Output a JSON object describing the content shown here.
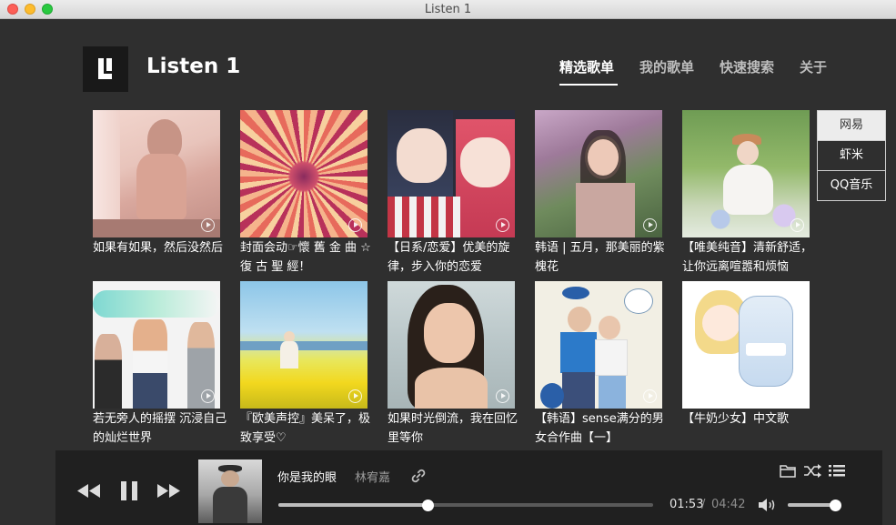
{
  "window": {
    "title": "Listen 1"
  },
  "app": {
    "name": "Listen 1"
  },
  "nav": [
    {
      "label": "精选歌单",
      "active": true
    },
    {
      "label": "我的歌单",
      "active": false
    },
    {
      "label": "快速搜索",
      "active": false
    },
    {
      "label": "关于",
      "active": false
    }
  ],
  "sources": [
    {
      "label": "网易",
      "active": true
    },
    {
      "label": "虾米",
      "active": false
    },
    {
      "label": "QQ音乐",
      "active": false
    }
  ],
  "playlists": [
    {
      "title": "如果有如果，然后没然后",
      "cover": "cover-sad-girl"
    },
    {
      "title": "封面会动☞懷 舊 金 曲 ☆ 復 古 聖 經！",
      "cover": "cover-optical-illusion"
    },
    {
      "title": "【日系/恋爱】优美的旋律，步入你的恋爱",
      "cover": "cover-anime-girls"
    },
    {
      "title": "韩语 | 五月，那美丽的紫槐花",
      "cover": "cover-girl-flowers"
    },
    {
      "title": "【唯美纯音】清新舒适，让你远离喧嚣和烦恼",
      "cover": "cover-girl-garden"
    },
    {
      "title": "若无旁人的摇摆 沉浸自己的灿烂世界",
      "cover": "cover-friends-smoke"
    },
    {
      "title": "『欧美声控』美呆了，极致享受♡",
      "cover": "cover-rapeseed-field"
    },
    {
      "title": "如果时光倒流，我在回忆里等你",
      "cover": "cover-girl-portrait"
    },
    {
      "title": "【韩语】sense满分的男女合作曲【一】",
      "cover": "cover-couple-cartoon"
    },
    {
      "title": "【牛奶少女】中文歌",
      "cover": "cover-milk-girl"
    }
  ],
  "player": {
    "song": "你是我的眼",
    "artist": "林宥嘉",
    "current_time": "01:53",
    "separator": "/",
    "total_time": "04:42",
    "progress": 0.4,
    "volume": 0.96,
    "album_cover": "album-man-in-hat"
  },
  "colors": {
    "background": "#2f2f2f",
    "player_bar": "#202020",
    "text": "#ffffff",
    "muted": "#9a9a9a"
  }
}
